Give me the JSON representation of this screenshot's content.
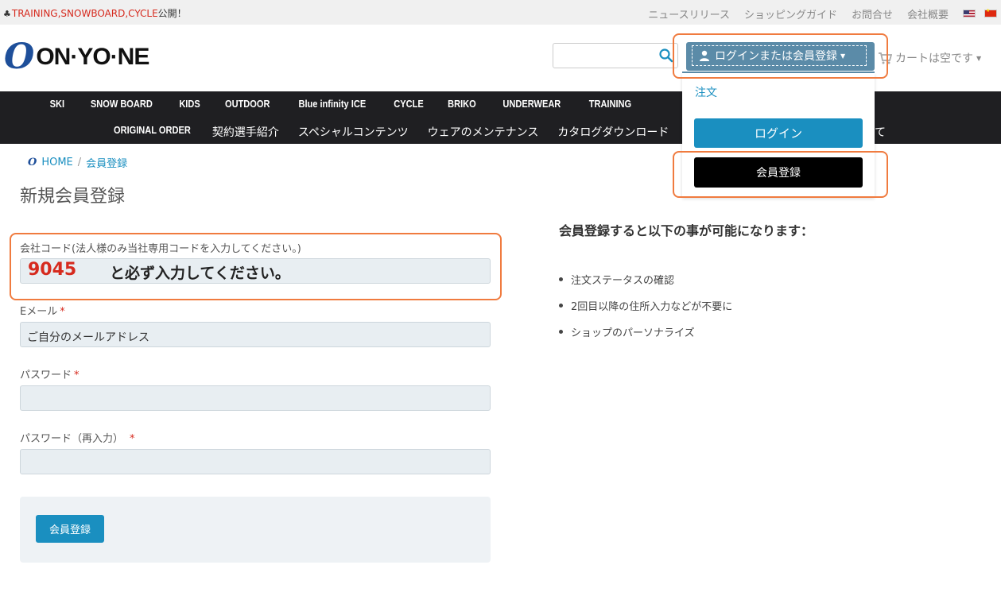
{
  "announcement": {
    "prefix_icon": "bell-icon",
    "highlight": "TRAINING,SNOWBOARD,CYCLE",
    "rest": "公開！"
  },
  "top_links": [
    "ニュースリリース",
    "ショッピングガイド",
    "お問合せ",
    "会社概要"
  ],
  "logo": {
    "mark": "O",
    "text": "ON·YO·NE"
  },
  "header": {
    "login_button": "ログインまたは会員登録",
    "cart": "カートは空です"
  },
  "nav": {
    "row1": [
      "SKI",
      "SNOW BOARD",
      "KIDS",
      "OUTDOOR",
      "Blue infinity ICE",
      "CYCLE",
      "BRIKO",
      "UNDERWEAR",
      "TRAINING"
    ],
    "row2": [
      "ORIGINAL ORDER",
      "契約選手紹介",
      "スペシャルコンテンツ",
      "ウェアのメンテナンス",
      "カタログダウンロード"
    ],
    "row2_partial": "て"
  },
  "dropdown": {
    "order": "注文",
    "login": "ログイン",
    "register": "会員登録"
  },
  "breadcrumb": {
    "home": "HOME",
    "separator": "/",
    "current": "会員登録"
  },
  "page_title": "新規会員登録",
  "form": {
    "company_code_label": "会社コード(法人様のみ当社専用コードを入力してください。)",
    "company_code_value": "9045",
    "company_code_note": "と必ず入力してください。",
    "email_label": "Eメール",
    "email_value": "ご自分のメールアドレス",
    "password_label": "パスワード",
    "password_confirm_label": "パスワード（再入力）",
    "required_mark": "*",
    "submit": "会員登録"
  },
  "benefits": {
    "title": "会員登録すると以下の事が可能になります：",
    "items": [
      "注文ステータスの確認",
      "2回目以降の住所入力などが不要に",
      "ショップのパーソナライズ"
    ]
  },
  "colors": {
    "accent": "#1a8fc0",
    "highlight": "#f07b3f",
    "nav_bg": "#1f1f22",
    "login_bg": "#5b8ba8",
    "required": "#d62a1e"
  }
}
